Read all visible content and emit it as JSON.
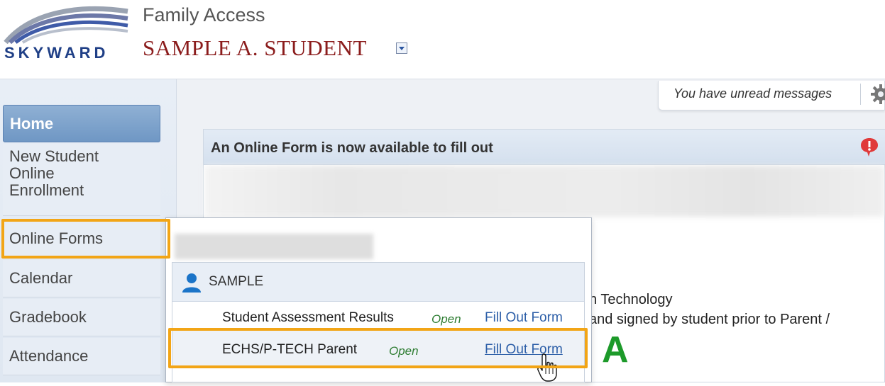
{
  "header": {
    "logo_text": "SKYWARD",
    "app_title": "Family Access",
    "student_name": "SAMPLE A. STUDENT"
  },
  "sidebar": {
    "items": [
      {
        "label": "Home",
        "active": true
      },
      {
        "label": "New Student Online Enrollment",
        "lines": [
          "New Student",
          "Online",
          "Enrollment"
        ]
      },
      {
        "label": "Online Forms",
        "highlighted": true
      },
      {
        "label": "Calendar"
      },
      {
        "label": "Gradebook"
      },
      {
        "label": "Attendance"
      }
    ]
  },
  "messages": {
    "unread_text": "You have unread messages"
  },
  "main": {
    "panel_title": "An Online Form is now available to fill out",
    "partial_text_1": "n Technology",
    "partial_text_2": "and signed by student prior to Parent /",
    "grade_letter": "A"
  },
  "flyout": {
    "student": "SAMPLE",
    "forms": [
      {
        "name": "Student Assessment Results",
        "status": "Open",
        "action": "Fill Out Form"
      },
      {
        "name": "ECHS/P-TECH Parent",
        "status": "Open",
        "action": "Fill Out Form",
        "highlighted": true
      }
    ]
  },
  "colors": {
    "highlight": "#f2a516",
    "student_name": "#8b1c1c",
    "link": "#2d5fa8",
    "status": "#2e7d32",
    "nav_active": "#7aa0ca",
    "grade": "#1d9a2a"
  },
  "icons": [
    "skyward-logo",
    "chevron-down-icon",
    "gear-icon",
    "alert-icon",
    "person-icon",
    "hand-cursor-icon"
  ]
}
